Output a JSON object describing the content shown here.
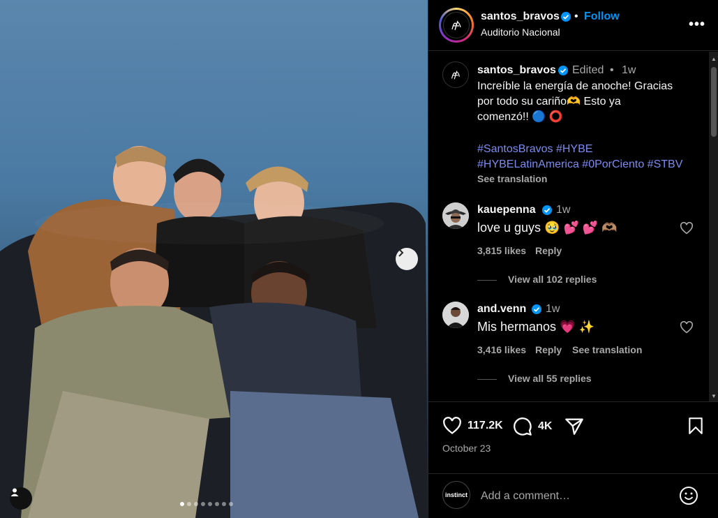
{
  "photo": {
    "carousel_dots": 8,
    "active_dot": 0
  },
  "post": {
    "username": "santos_bravos",
    "follow_label": "Follow",
    "separator": "•",
    "location": "Auditorio Nacional",
    "caption": {
      "edited_label": "Edited",
      "dot": "•",
      "time": "1w",
      "line1": "Increíble la energía de anoche! Gracias",
      "line2": "por todo su cariño🫶 Esto ya",
      "line3": "comenzó!! 🔵 ⭕",
      "hashtags_line1": "#SantosBravos #HYBE",
      "hashtags_line2": "#HYBELatinAmerica #0PorCiento #STBV",
      "see_translation": "See translation"
    },
    "comments": [
      {
        "username": "kauepenna",
        "time": "1w",
        "text": "love u guys 🥹 💕 💕 🫶🏽",
        "likes": "3,815 likes",
        "reply": "Reply",
        "view_replies": "View all 102 replies"
      },
      {
        "username": "and.venn",
        "time": "1w",
        "text": "Mis hermanos 💗 ✨",
        "likes": "3,416 likes",
        "reply": "Reply",
        "see_translation": "See translation",
        "view_replies": "View all 55 replies"
      }
    ],
    "like_count": "117.2K",
    "comment_count": "4K",
    "date": "October 23",
    "comment_avatar_text": "instinct",
    "comment_placeholder": "Add a comment…"
  },
  "colors": {
    "accent": "#0095f6",
    "hashtag": "#7c8bf0",
    "background": "#000000",
    "muted": "#a8a8a8"
  }
}
